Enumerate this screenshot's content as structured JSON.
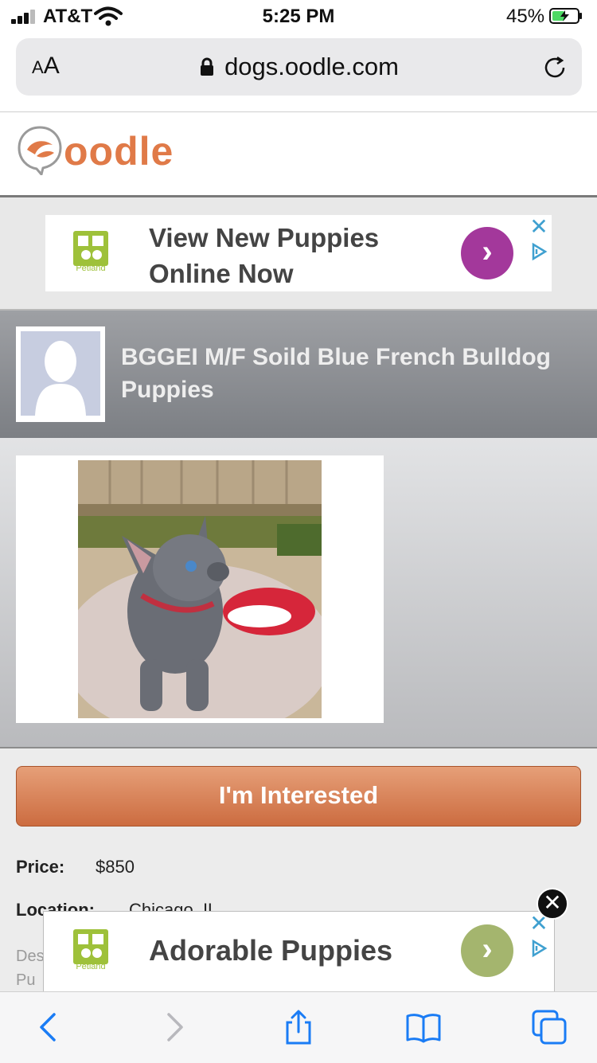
{
  "status_bar": {
    "carrier": "AT&T",
    "time": "5:25 PM",
    "battery_percent": "45%"
  },
  "browser": {
    "text_size_label_small": "A",
    "text_size_label_large": "A",
    "url": "dogs.oodle.com"
  },
  "site": {
    "logo_text": "oodle",
    "brand_color": "#e07a48"
  },
  "ad_top": {
    "brand": "Petland",
    "headline": "View New Puppies Online Now",
    "arrow_color": "#a3389b",
    "close": "✕",
    "arrow": "›"
  },
  "listing": {
    "title": "BGGEI M/F Soild Blue French Bulldog Puppies",
    "interested_button": "I'm Interested",
    "price_label": "Price:",
    "price_value": "$850",
    "location_label": "Location:",
    "location_value": "Chicago, IL",
    "description_label_fragment": "Des",
    "description_fragment": "Pu"
  },
  "ad_bottom": {
    "brand": "Petland",
    "headline": "Adorable Puppies",
    "arrow_color": "#a4b56e",
    "close": "✕",
    "arrow": "›",
    "dismiss": "✕"
  },
  "toolbar": {
    "icons": [
      "back-icon",
      "forward-icon",
      "share-icon",
      "bookmarks-icon",
      "tabs-icon"
    ],
    "accent_color": "#1a7cf5"
  }
}
